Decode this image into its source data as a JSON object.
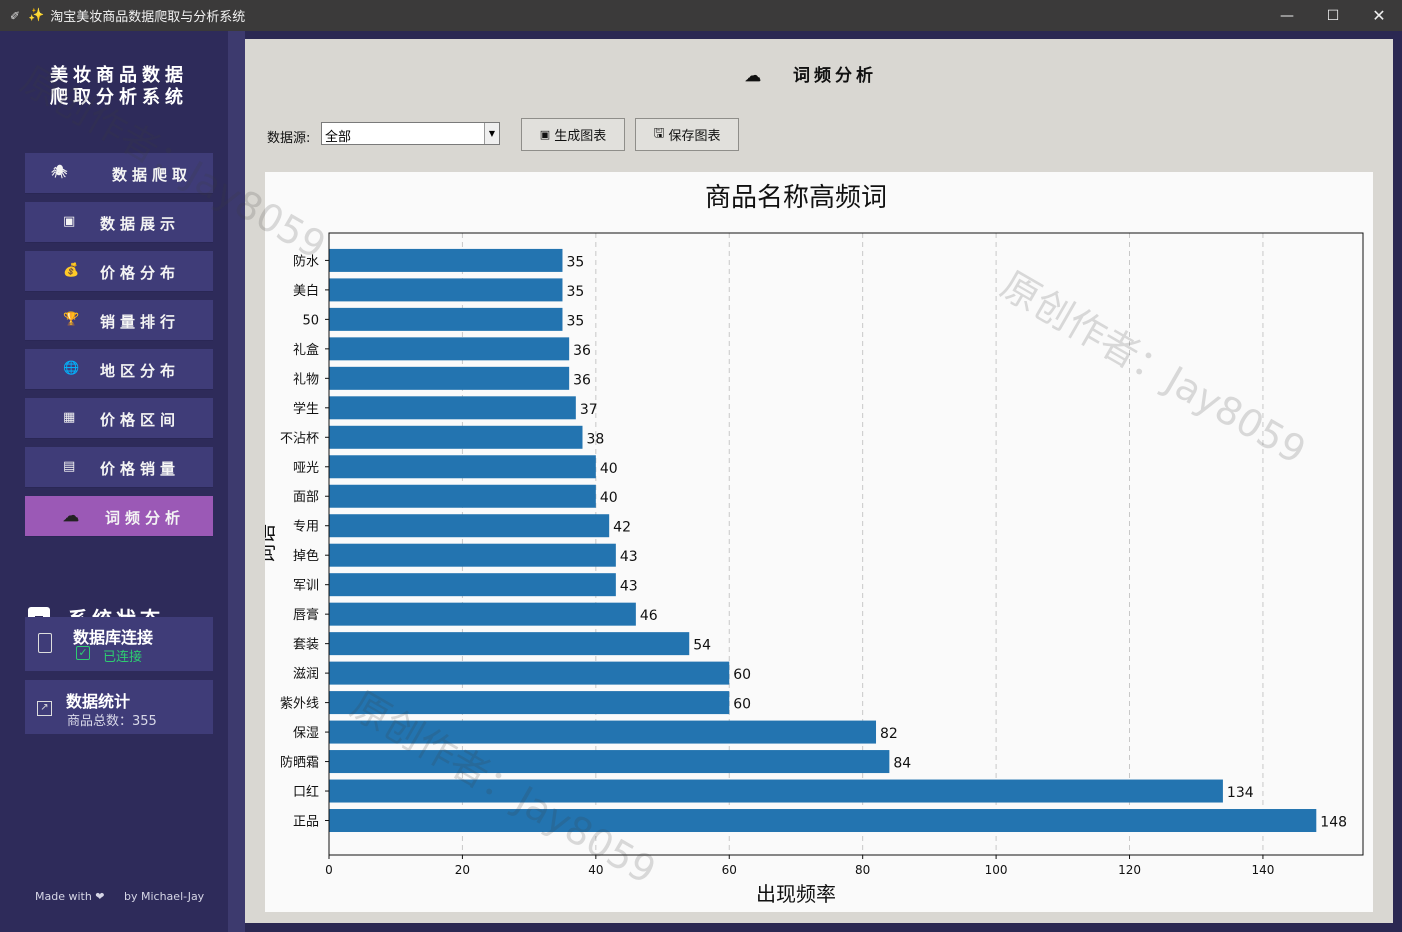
{
  "window": {
    "title": "淘宝美妆商品数据爬取与分析系统",
    "minimize_icon": "—",
    "maximize_icon": "☐",
    "close_icon": "✕"
  },
  "sidebar": {
    "logo_line1": "美妆商品数据",
    "logo_line2": "爬取分析系统",
    "nav": [
      {
        "icon": "spider-icon",
        "glyph": "🕷",
        "label": "数据爬取"
      },
      {
        "icon": "box-icon",
        "glyph": "▣",
        "label": "数据展示"
      },
      {
        "icon": "money-bag-icon",
        "glyph": "💰",
        "label": "价格分布"
      },
      {
        "icon": "trophy-icon",
        "glyph": "🏆",
        "label": "销量排行"
      },
      {
        "icon": "globe-icon",
        "glyph": "🌐",
        "label": "地区分布"
      },
      {
        "icon": "chart-icon",
        "glyph": "▦",
        "label": "价格区间"
      },
      {
        "icon": "grid-chart-icon",
        "glyph": "▤",
        "label": "价格销量"
      },
      {
        "icon": "cloud-icon",
        "glyph": "☁",
        "label": "词频分析"
      }
    ],
    "active_index": 7,
    "status_title": "系统状态",
    "db": {
      "title": "数据库连接",
      "status": "已连接",
      "status_color": "#2ecc71"
    },
    "stats": {
      "title": "数据统计",
      "label": "商品总数：355"
    },
    "footer_made": "Made with ❤",
    "footer_by": "by Michael-Jay"
  },
  "main": {
    "page_title": "词频分析",
    "page_icon": "☁",
    "datasource_label": "数据源:",
    "datasource_value": "全部",
    "generate_label": "生成图表",
    "save_label": "保存图表"
  },
  "watermark": "原创作者：Jay8059",
  "chart_data": {
    "type": "bar",
    "orientation": "horizontal",
    "title": "商品名称高频词",
    "xlabel": "出现频率",
    "ylabel": "词语",
    "xlim": [
      0,
      155
    ],
    "xticks": [
      0,
      20,
      40,
      60,
      80,
      100,
      120,
      140
    ],
    "grid": "x-dashed",
    "color": "#2374b0",
    "categories": [
      "防水",
      "美白",
      "50",
      "礼盒",
      "礼物",
      "学生",
      "不沾杯",
      "哑光",
      "面部",
      "专用",
      "掉色",
      "军训",
      "唇膏",
      "套装",
      "滋润",
      "紫外线",
      "保湿",
      "防晒霜",
      "口红",
      "正品"
    ],
    "values": [
      35,
      35,
      35,
      36,
      36,
      37,
      38,
      40,
      40,
      42,
      43,
      43,
      46,
      54,
      60,
      60,
      82,
      84,
      134,
      148
    ]
  }
}
